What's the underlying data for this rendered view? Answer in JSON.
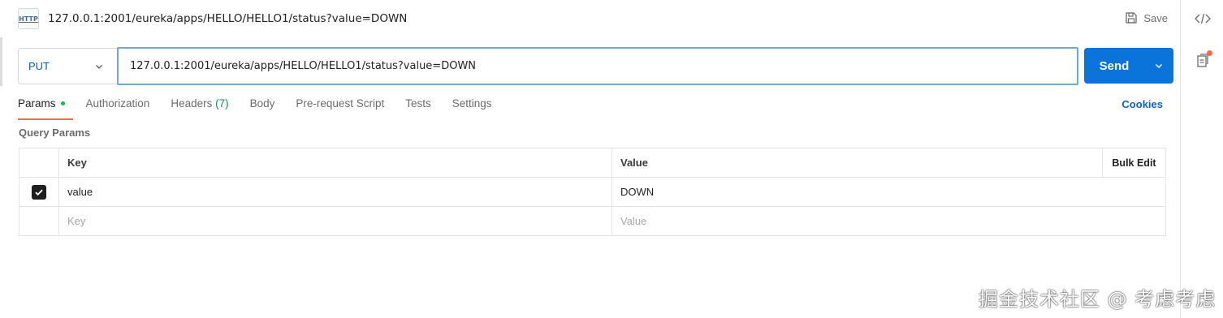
{
  "header": {
    "icon_text": "HTTP",
    "title": "127.0.0.1:2001/eureka/apps/HELLO/HELLO1/status?value=DOWN",
    "save_label": "Save"
  },
  "request": {
    "method": "PUT",
    "url": "127.0.0.1:2001/eureka/apps/HELLO/HELLO1/status?value=DOWN",
    "send_label": "Send"
  },
  "tabs": [
    {
      "label": "Params",
      "active": true
    },
    {
      "label": "Authorization"
    },
    {
      "label": "Headers",
      "count": "(7)"
    },
    {
      "label": "Body"
    },
    {
      "label": "Pre-request Script"
    },
    {
      "label": "Tests"
    },
    {
      "label": "Settings"
    }
  ],
  "cookies_label": "Cookies",
  "query_params": {
    "title": "Query Params",
    "headers": {
      "key": "Key",
      "value": "Value",
      "bulk_edit": "Bulk Edit"
    },
    "rows": [
      {
        "checked": true,
        "key": "value",
        "value": "DOWN"
      }
    ],
    "placeholder": {
      "key": "Key",
      "value": "Value"
    }
  },
  "watermark": "掘金技术社区 @ 考虑考虑",
  "colors": {
    "accent": "#ff6c37",
    "primary": "#0a74da",
    "url_border": "#6fa6db",
    "active_dot": "#0cbb52"
  }
}
